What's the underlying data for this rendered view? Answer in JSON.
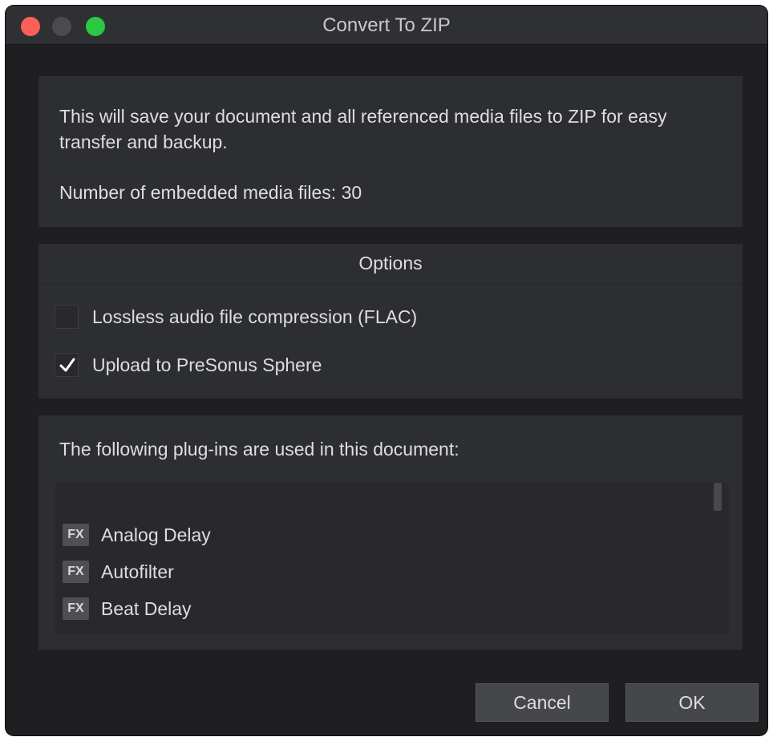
{
  "window": {
    "title": "Convert To ZIP"
  },
  "traffic_lights": {
    "close_color": "#fe5f58",
    "minimize_color": "#4b4b4d",
    "maximize_color": "#29c941"
  },
  "info": {
    "description": "This will save your document and all referenced media files to ZIP for easy transfer and backup.",
    "media_count_text": "Number of embedded media files: 30"
  },
  "options": {
    "header": "Options",
    "items": [
      {
        "label": "Lossless audio file compression (FLAC)",
        "checked": false
      },
      {
        "label": "Upload to PreSonus Sphere",
        "checked": true
      }
    ]
  },
  "plugins": {
    "heading": "The following plug-ins are used in this document:",
    "badge": "FX",
    "items": [
      {
        "name": "Analog Delay"
      },
      {
        "name": "Autofilter"
      },
      {
        "name": "Beat Delay"
      }
    ]
  },
  "buttons": {
    "cancel": "Cancel",
    "ok": "OK"
  }
}
